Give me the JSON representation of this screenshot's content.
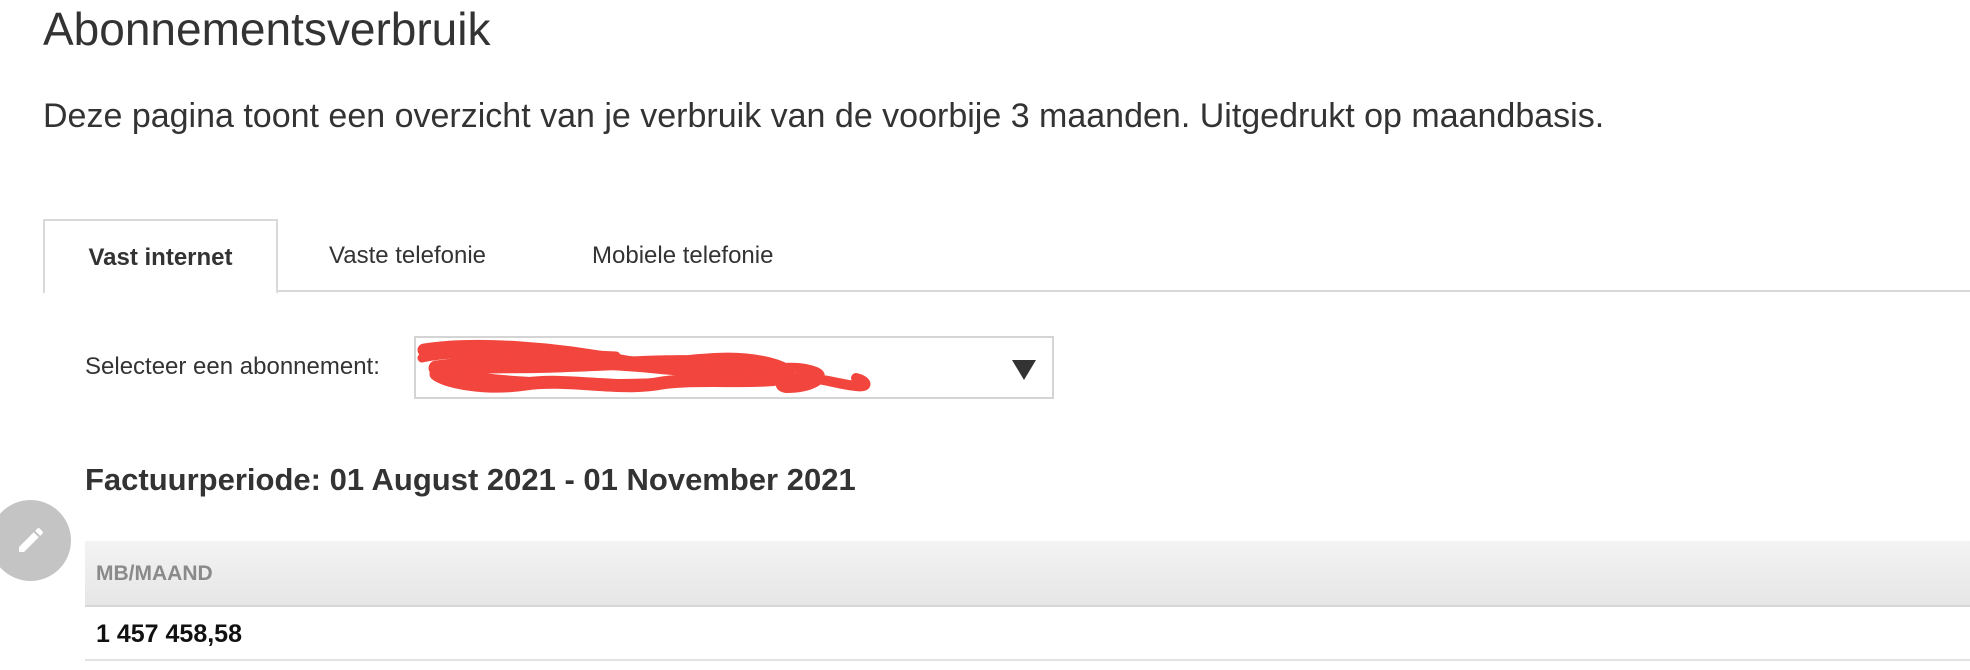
{
  "page": {
    "title": "Abonnementsverbruik",
    "intro": "Deze pagina toont een overzicht van je verbruik van de voorbije 3 maanden. Uitgedrukt op maandbasis."
  },
  "tabs": [
    {
      "label": "Vast internet",
      "active": true
    },
    {
      "label": "Vaste telefonie",
      "active": false
    },
    {
      "label": "Mobiele telefonie",
      "active": false
    }
  ],
  "subscription_select": {
    "label": "Selecteer een abonnement:",
    "value_redacted": true,
    "arrow_icon": "triangle-down-icon"
  },
  "period": {
    "heading": "Factuurperiode: 01 August 2021 - 01 November 2021"
  },
  "usage_table": {
    "columns": [
      "MB/MAAND"
    ],
    "rows": [
      [
        "1 457 458,58"
      ]
    ]
  },
  "edit_button": {
    "icon": "pencil-icon"
  },
  "colors": {
    "text": "#333333",
    "border": "#d9d9d9",
    "table_header_text": "#8a8a8a",
    "redaction": "#f2453d",
    "fab": "#c4c4c4"
  }
}
